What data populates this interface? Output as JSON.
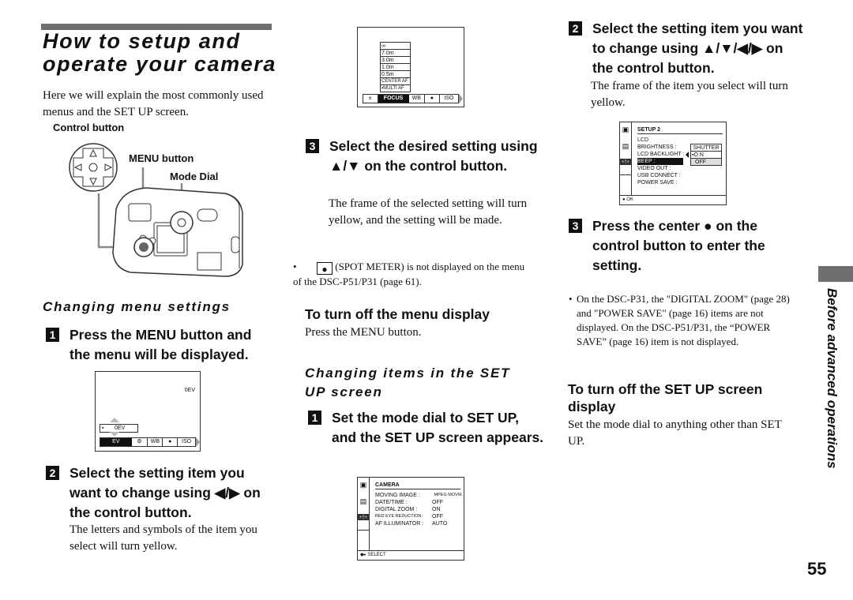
{
  "page": {
    "title_line1": "How to setup and",
    "title_line2": "operate your camera",
    "intro": "Here we will explain the most commonly used menus and the SET UP screen.",
    "page_number": "55",
    "side_label": "Before advanced operations"
  },
  "figure_camera": {
    "control_button_label": "Control button",
    "menu_button_label": "MENU button",
    "mode_dial_label": "Mode Dial"
  },
  "section_menu": {
    "heading": "Changing menu settings",
    "step1": {
      "num": "1",
      "text": "Press the MENU button and the menu will be displayed."
    },
    "screen_ev": {
      "ev_value_top": "0EV",
      "ev_value_box": "0EV",
      "tabs": [
        "EV",
        "⚙",
        "WB",
        "●",
        "ISO"
      ]
    },
    "step2": {
      "num": "2",
      "text": "Select the setting item you want to change using ◀/▶ on the control button.",
      "desc": "The letters and symbols of the item you select will turn yellow."
    },
    "screen_focus": {
      "options": [
        "∞",
        "7.0m",
        "3.0m",
        "1.0m",
        "0.5m",
        "CENTER AF",
        "▪MULTI AF"
      ],
      "tabs": [
        "±",
        "FOCUS",
        "WB",
        "●",
        "ISO"
      ]
    },
    "step3": {
      "num": "3",
      "text": "Select the desired setting using ▲/▼ on the control button.",
      "desc": "The frame of the selected setting will turn yellow, and the setting will be made."
    },
    "note": "(SPOT METER) is not displayed on the menu of the DSC-P51/P31 (page 61).",
    "turn_off_heading": "To turn off the menu display",
    "turn_off_text": "Press the MENU button."
  },
  "section_setup": {
    "heading": "Changing items in the SET UP screen",
    "step1": {
      "num": "1",
      "text": "Set the mode dial to SET UP, and the SET UP screen appears."
    },
    "screen_camera": {
      "title": "CAMERA",
      "rows": [
        {
          "label": "MOVING IMAGE :",
          "value": "MPEG MOVIE"
        },
        {
          "label": "DATE/TIME :",
          "value": "OFF"
        },
        {
          "label": "DIGITAL ZOOM :",
          "value": "ON"
        },
        {
          "label": "RED EYE REDUCTION :",
          "value": "OFF"
        },
        {
          "label": "AF ILLUMINATOR :",
          "value": "AUTO"
        }
      ],
      "footer": "SELECT"
    },
    "step2": {
      "num": "2",
      "text": "Select the setting item you want to change using ▲/▼/◀/▶ on the control button.",
      "desc": "The frame of the item you select will turn yellow."
    },
    "screen_setup2": {
      "title": "SETUP 2",
      "rows": [
        "LCD BRIGHTNESS :",
        "LCD BACKLIGHT :",
        "BEEP :",
        "VIDEO OUT :",
        "USB CONNECT :",
        "POWER SAVE :"
      ],
      "options": [
        "SHUTTER",
        "▪O N",
        "OFF"
      ],
      "footer": "OK"
    },
    "step3": {
      "num": "3",
      "text": "Press the center ● on the control button to enter the setting."
    },
    "note": "On the DSC-P31, the \"DIGITAL ZOOM\" (page 28) and \"POWER SAVE\" (page 16) items are not displayed. On the DSC-P51/P31, the “POWER SAVE” (page 16) item is not displayed.",
    "turn_off_heading": "To turn off the SET UP screen display",
    "turn_off_text": "Set the mode dial to anything other than SET UP."
  }
}
